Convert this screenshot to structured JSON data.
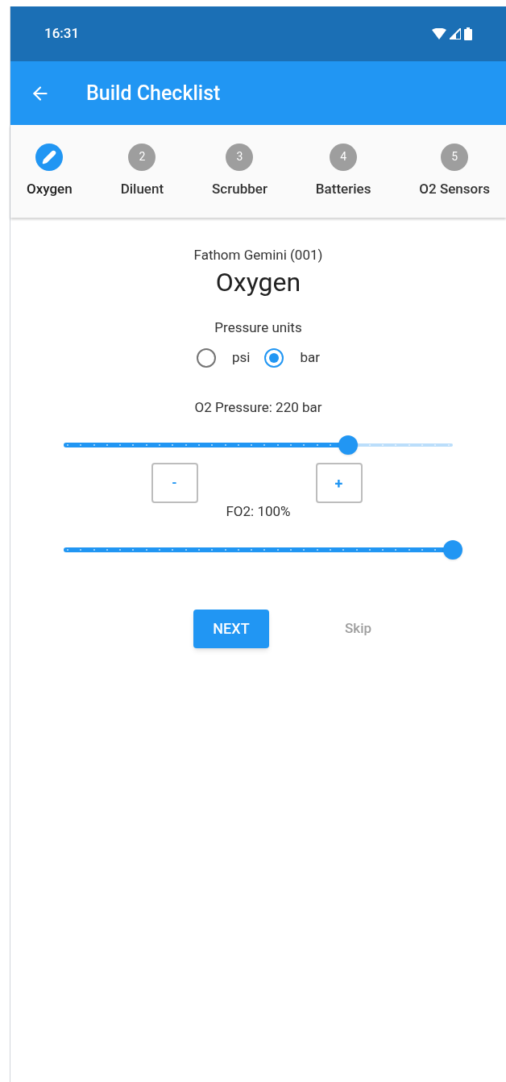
{
  "status_bar": {
    "time": "16:31"
  },
  "app_bar": {
    "title": "Build Checklist"
  },
  "steps": [
    {
      "label": "Oxygen",
      "selected": true
    },
    {
      "label": "Diluent",
      "number": "2",
      "selected": false
    },
    {
      "label": "Scrubber",
      "number": "3",
      "selected": false
    },
    {
      "label": "Batteries",
      "number": "4",
      "selected": false
    },
    {
      "label": "O2 Sensors",
      "number": "5",
      "selected": false
    }
  ],
  "device": "Fathom Gemini (001)",
  "heading": "Oxygen",
  "pressure_units": {
    "label": "Pressure units",
    "options": [
      {
        "label": "psi",
        "selected": false
      },
      {
        "label": "bar",
        "selected": true
      }
    ]
  },
  "o2_pressure": {
    "label": "O2 Pressure: 220 bar",
    "level": 0.73,
    "decrease": "-",
    "increase": "+"
  },
  "fo2": {
    "label": "FO2: 100%",
    "level": 1
  },
  "buttons": {
    "next": "NEXT",
    "skip": "Skip"
  }
}
